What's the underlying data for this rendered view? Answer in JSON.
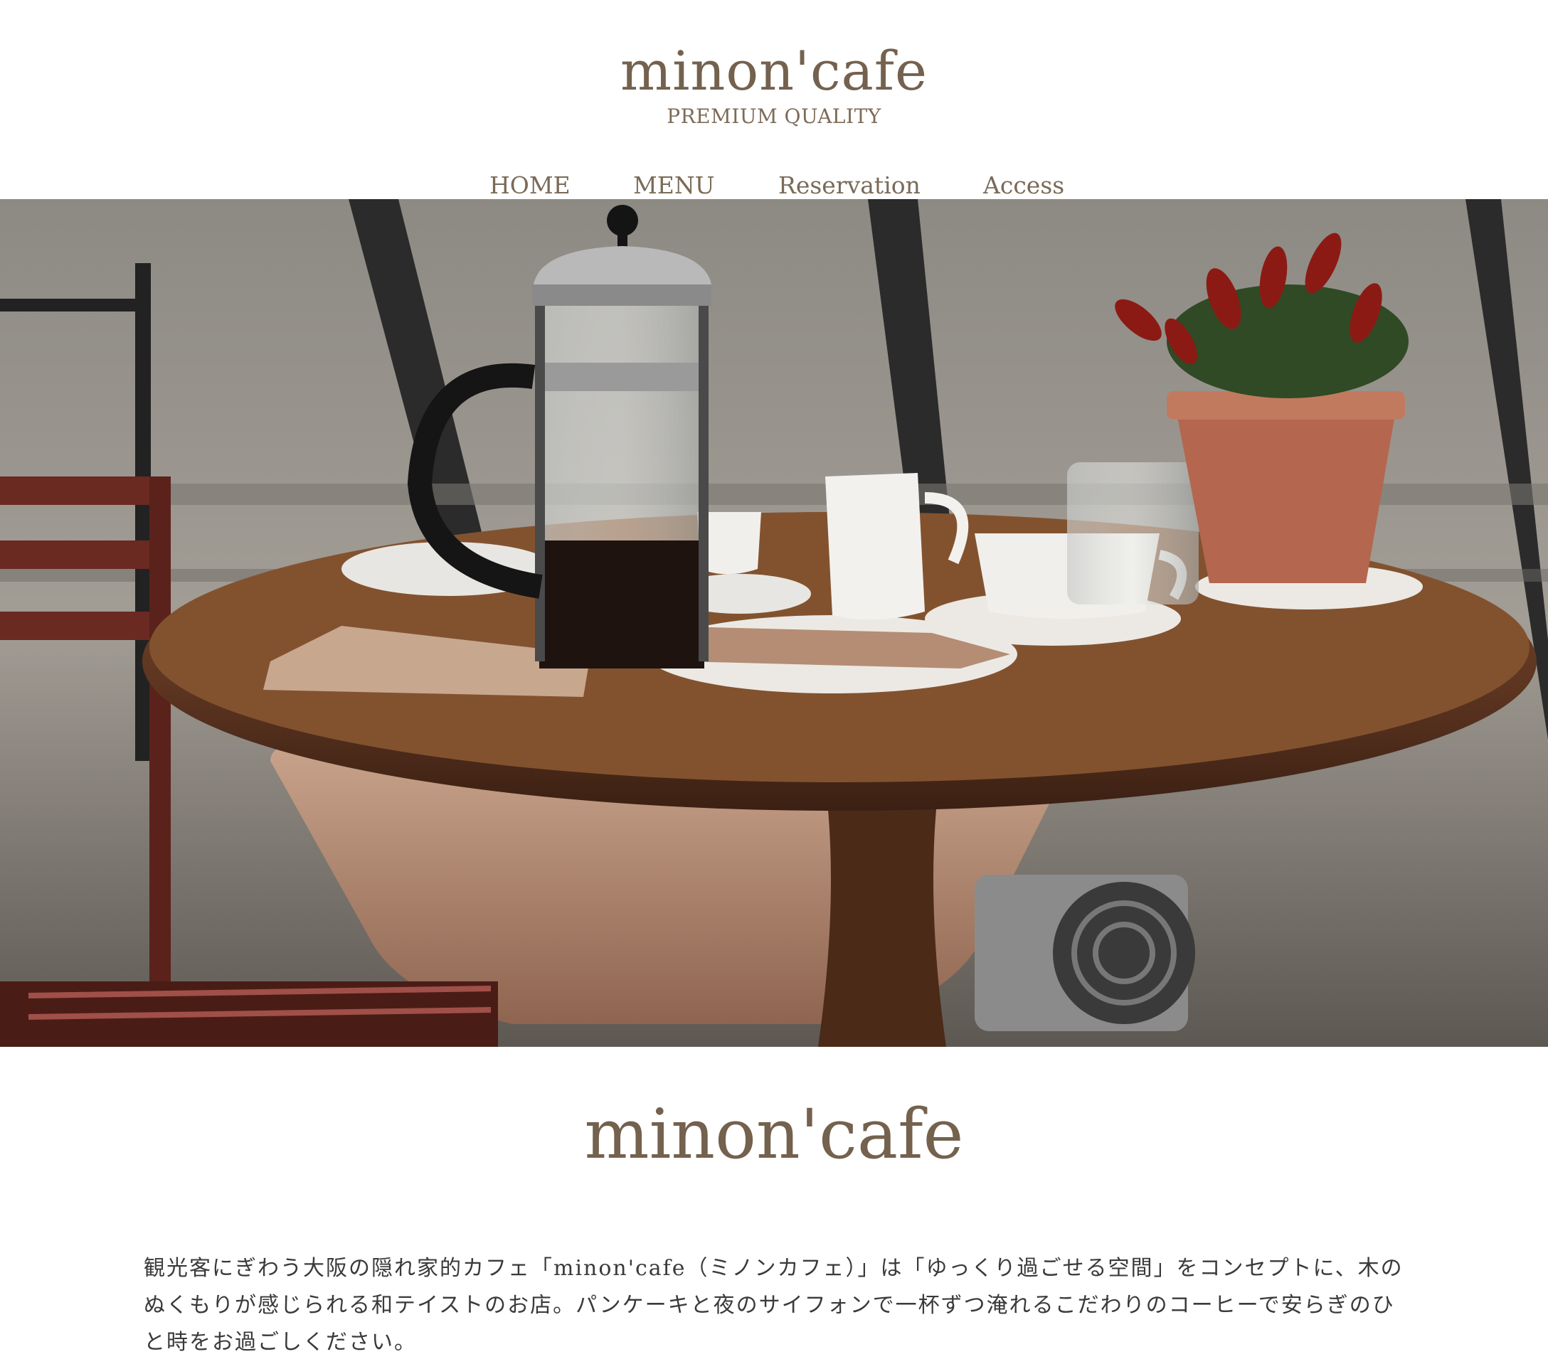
{
  "header": {
    "logo": "minon'cafe",
    "tagline": "PREMIUM QUALITY"
  },
  "nav": {
    "items": [
      {
        "label": "HOME"
      },
      {
        "label": "MENU"
      },
      {
        "label": "Reservation"
      },
      {
        "label": "Access"
      }
    ]
  },
  "hero": {
    "image_description_icon": "cafe-table-photo"
  },
  "main": {
    "title": "minon'cafe",
    "body": "観光客にぎわう大阪の隠れ家的カフェ「minon'cafe（ミノンカフェ）」は「ゆっくり過ごせる空間」をコンセプトに、木のぬくもりが感じられる和テイストのお店。パンケーキと夜のサイフォンで一杯ずつ淹れるこだわりのコーヒーで安らぎのひと時をお過ごしください。"
  },
  "colors": {
    "brand": "#74614e",
    "text": "#3a3a3a",
    "background": "#ffffff"
  }
}
